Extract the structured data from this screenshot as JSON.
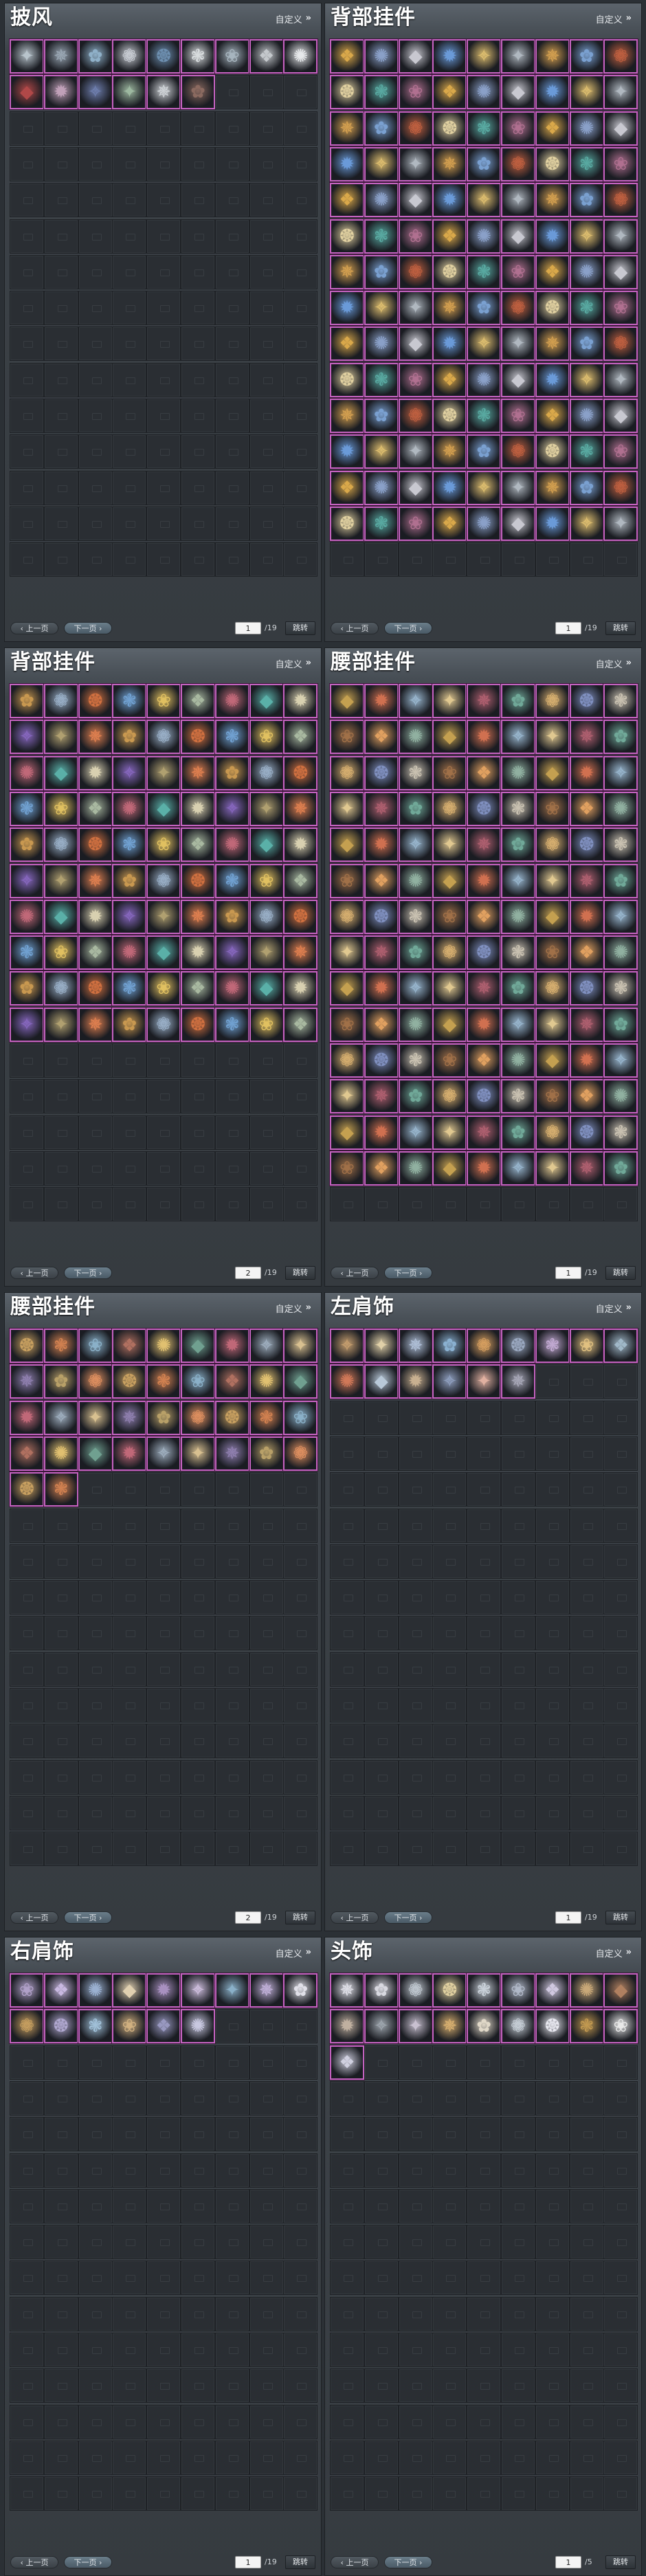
{
  "common": {
    "customize_label": "自定义",
    "prev_label": "上一页",
    "next_label": "下一页",
    "jump_label": "跳转",
    "filled_border_color": "#c463c0"
  },
  "panels": [
    {
      "title": "披风",
      "page": "1",
      "total": "/19",
      "filled": 15,
      "item_colors": [
        "#b8c4cc",
        "#9aa7b4",
        "#8fb0c8",
        "#c9cdd4",
        "#6d8fb0",
        "#d8dcde",
        "#a7b5bf",
        "#c4c8cc",
        "#e6e8ea",
        "#b04848",
        "#c0a0b8",
        "#7080b0",
        "#9db8a0",
        "#d0d4d8",
        "#8b6a60"
      ]
    },
    {
      "title": "背部挂件",
      "page": "1",
      "total": "/19",
      "filled": 126,
      "item_colors": [
        "#d9a84a",
        "#8aa0c8",
        "#c8c8d0",
        "#6a9ad8",
        "#e0c070",
        "#b0b8c0",
        "#d4a050",
        "#7aa0d0",
        "#c06040",
        "#e0d0a0",
        "#58a8a0",
        "#b07090"
      ]
    },
    {
      "title": "背部挂件",
      "page": "2",
      "total": "/19",
      "filled": 90,
      "item_colors": [
        "#c89850",
        "#9ab0c8",
        "#d07040",
        "#70a0d0",
        "#e0c060",
        "#a8b8a0",
        "#c06878",
        "#5ab0a8",
        "#d8d0b0",
        "#8868c0",
        "#b0a070",
        "#e08050"
      ]
    },
    {
      "title": "腰部挂件",
      "page": "1",
      "total": "/19",
      "filled": 126,
      "item_colors": [
        "#c4a050",
        "#d07050",
        "#9ab8d0",
        "#e0c890",
        "#b06070",
        "#70a898",
        "#d8b070",
        "#8090c0",
        "#c8c0b0",
        "#a07048",
        "#e0a060",
        "#90b0a0"
      ]
    },
    {
      "title": "腰部挂件",
      "page": "2",
      "total": "/19",
      "filled": 38,
      "item_colors": [
        "#c8a060",
        "#d08050",
        "#8ab0c8",
        "#b07060",
        "#e0c070",
        "#70a090",
        "#c06878",
        "#a0b0c0",
        "#d8c090",
        "#9080b0",
        "#b8a068",
        "#e09060"
      ]
    },
    {
      "title": "左肩饰",
      "page": "1",
      "total": "/19",
      "filled": 15,
      "item_colors": [
        "#c8a070",
        "#e0d0a8",
        "#b0c0d8",
        "#8ab0d0",
        "#d8a060",
        "#9aa8c0",
        "#c0a8d0",
        "#e0c080",
        "#a0b8c8",
        "#d07858",
        "#b8c8d8",
        "#c8b090",
        "#90a0c0",
        "#e0b0a0",
        "#a8a8b8"
      ]
    },
    {
      "title": "右肩饰",
      "page": "1",
      "total": "/19",
      "filled": 15,
      "item_colors": [
        "#b0a0c8",
        "#c8b8e0",
        "#9ab0d0",
        "#e0d0b0",
        "#a890c0",
        "#d0c0e0",
        "#8ab0c8",
        "#c0b0d8",
        "#e0e0e8",
        "#c8a060",
        "#b0a8d0",
        "#a0c0d8",
        "#d0b080",
        "#9898c0",
        "#c8c8e0"
      ]
    },
    {
      "title": "头饰",
      "page": "1",
      "total": "/5",
      "filled": 19,
      "item_colors": [
        "#e0e0e8",
        "#d8d8e0",
        "#c0c8d0",
        "#e0d0a0",
        "#c8d0d8",
        "#b0b8c8",
        "#d0c8e0",
        "#c8a878",
        "#b08060",
        "#c0b0a0",
        "#a0a8b0",
        "#c8c0d0",
        "#d8b070",
        "#e0d8c8",
        "#c8d0d8",
        "#e8e8f0",
        "#c09850",
        "#e8e8e8",
        "#d0d0e0"
      ]
    }
  ]
}
